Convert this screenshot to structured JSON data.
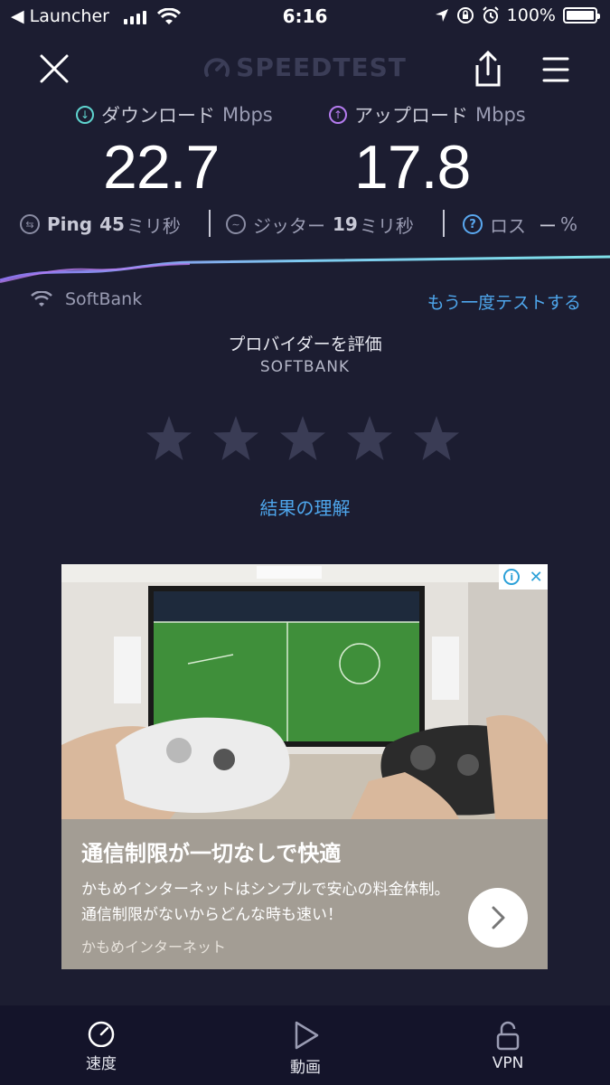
{
  "status_bar": {
    "back_label": "◀ Launcher",
    "time": "6:16",
    "battery": "100%"
  },
  "header": {
    "brand": "SPEEDTEST"
  },
  "results": {
    "download": {
      "label": "ダウンロード",
      "unit": "Mbps",
      "value": "22.7",
      "icon_color": "#5fd4cf"
    },
    "upload": {
      "label": "アップロード",
      "unit": "Mbps",
      "value": "17.8",
      "icon_color": "#b57cf0"
    },
    "ping": {
      "label": "Ping",
      "value": "45",
      "unit": "ミリ秒"
    },
    "jitter": {
      "label": "ジッター",
      "value": "19",
      "unit": "ミリ秒"
    },
    "loss": {
      "label": "ロス",
      "value": "ー",
      "unit": "%"
    }
  },
  "network": {
    "name": "SoftBank",
    "retest_label": "もう一度テストする"
  },
  "rating": {
    "title": "プロバイダーを評価",
    "provider": "SOFTBANK",
    "stars_total": 5,
    "stars_selected": 0,
    "understand_link": "結果の理解"
  },
  "ad": {
    "headline": "通信制限が一切なしで快適",
    "body": "かもめインターネットはシンプルで安心の料金体制。通信制限がないからどんな時も速い！",
    "advertiser": "かもめインターネット",
    "badge_close": "✕"
  },
  "tabs": [
    {
      "label": "速度",
      "icon": "speedometer-icon"
    },
    {
      "label": "動画",
      "icon": "play-icon"
    },
    {
      "label": "VPN",
      "icon": "lock-icon"
    }
  ],
  "colors": {
    "background": "#1c1d31",
    "accent_link": "#4ea6ec",
    "tabbar": "#14142a"
  }
}
